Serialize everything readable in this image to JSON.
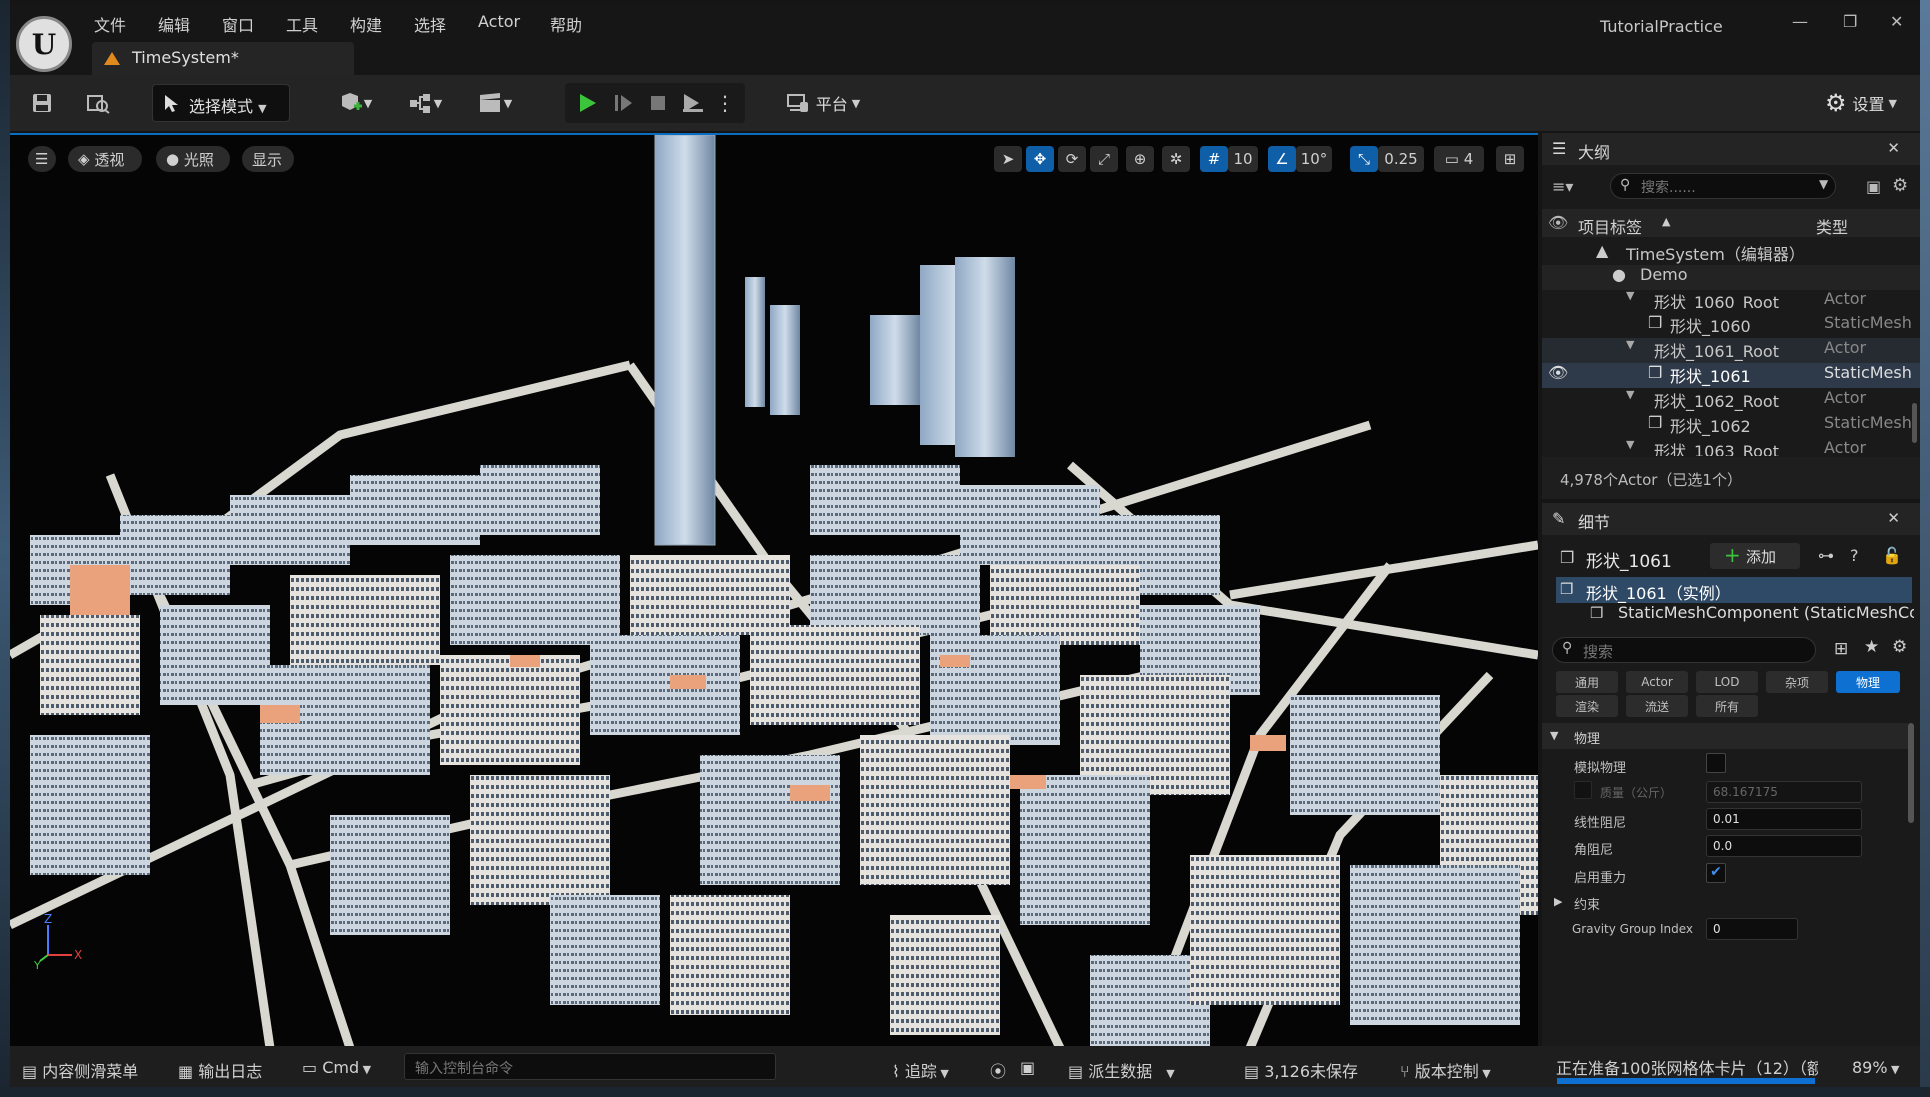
{
  "menu": [
    "文件",
    "编辑",
    "窗口",
    "工具",
    "构建",
    "选择",
    "Actor",
    "帮助"
  ],
  "tab": {
    "title": "TimeSystem*"
  },
  "project_name": "TutorialPractice",
  "toolbar": {
    "mode": "选择模式",
    "platform": "平台",
    "settings": "设置"
  },
  "viewport": {
    "perspective": "透视",
    "lighting": "光照",
    "show": "显示",
    "grid_snap": "10",
    "rotate_snap": "10°",
    "scale_snap": "0.25",
    "camera_speed": "4",
    "axis": {
      "z": "Z",
      "x": "X",
      "y": "Y"
    }
  },
  "outliner": {
    "title": "大纲",
    "search_placeholder": "搜索......",
    "col_label": "项目标签",
    "col_type": "类型",
    "rows": [
      {
        "label": "TimeSystem（编辑器）",
        "type": ""
      },
      {
        "label": "Demo",
        "type": ""
      },
      {
        "label": "形状_1060_Root",
        "type": "Actor"
      },
      {
        "label": "形状_1060",
        "type": "StaticMesh"
      },
      {
        "label": "形状_1061_Root",
        "type": "Actor"
      },
      {
        "label": "形状_1061",
        "type": "StaticMesh"
      },
      {
        "label": "形状_1062_Root",
        "type": "Actor"
      },
      {
        "label": "形状_1062",
        "type": "StaticMesh"
      },
      {
        "label": "形状_1063_Root",
        "type": "Actor"
      }
    ],
    "status": "4,978个Actor（已选1个）"
  },
  "details": {
    "title": "细节",
    "object_name": "形状_1061",
    "add_label": "添加",
    "instance": "形状_1061（实例）",
    "component": "StaticMeshComponent (StaticMeshCo",
    "search_placeholder": "搜索",
    "categories": [
      "通用",
      "Actor",
      "LOD",
      "杂项",
      "物理",
      "渲染",
      "流送",
      "所有"
    ],
    "section": "物理",
    "fields": {
      "simulate_physics": "模拟物理",
      "mass_label": "质量（公斤）",
      "mass_value": "68.167175",
      "linear_damping": "线性阻尼",
      "linear_damping_value": "0.01",
      "angular_damping": "角阻尼",
      "angular_damping_value": "0.0",
      "enable_gravity": "启用重力",
      "constraints": "约束",
      "gravity_group": "Gravity Group Index",
      "gravity_group_value": "0"
    }
  },
  "statusbar": {
    "content_drawer": "内容侧滑菜单",
    "output_log": "输出日志",
    "cmd": "Cmd",
    "cmd_placeholder": "输入控制台命令",
    "trace": "追踪",
    "derived_data": "派生数据",
    "unsaved": "3,126未保存",
    "source_control": "版本控制",
    "task": "正在准备100张网格体卡片（12）（额",
    "task_percent": "89%"
  }
}
